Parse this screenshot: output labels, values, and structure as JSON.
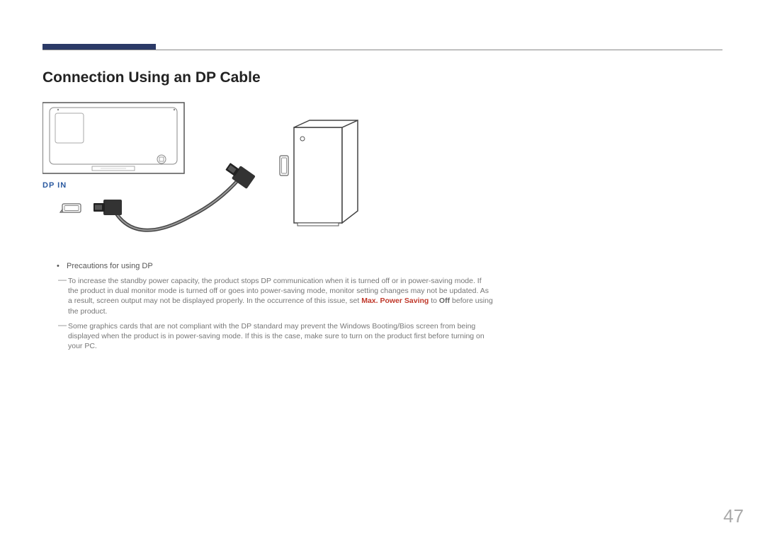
{
  "section_title": "Connection Using an DP Cable",
  "port_label": "DP IN",
  "bullet_label": "Precautions for using DP",
  "note1_pre": "To increase the standby power capacity, the product stops DP communication when it is turned off or in power-saving mode. If the product in dual monitor mode is turned off or goes into power-saving mode, monitor setting changes may not be updated. As a result, screen output may not be displayed properly. In the occurrence of this issue, set ",
  "note1_red": "Max. Power Saving",
  "note1_mid": " to ",
  "note1_bold": "Off",
  "note1_post": " before using the product.",
  "note2": "Some graphics cards that are not compliant with the DP standard may prevent the Windows Booting/Bios screen from being displayed when the product is in power-saving mode. If this is the case, make sure to turn on the product first before turning on your PC.",
  "page_number": "47"
}
